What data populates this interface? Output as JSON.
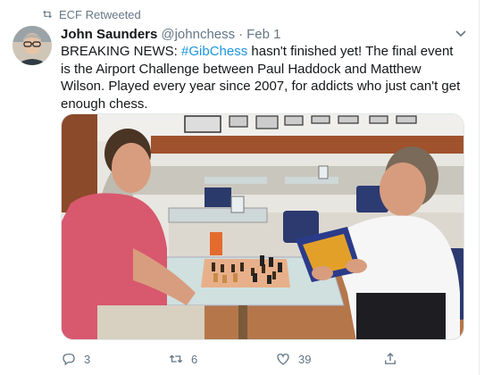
{
  "retweet": {
    "icon": "retweet-icon",
    "label": "ECF Retweeted"
  },
  "author": {
    "name": "John Saunders",
    "handle": "@johnchess",
    "separator": "·",
    "time": "Feb 1"
  },
  "tweet": {
    "text_part1": "BREAKING NEWS: ",
    "hashtag": "#GibChess",
    "text_part2": " hasn't  finished yet! The final event is the Airport Challenge between Paul Haddock and Matthew Wilson. Played every year since 2007, for addicts who just can't get enough chess."
  },
  "media": {
    "description_icon": "photo-chess-players"
  },
  "actions": {
    "replies": "3",
    "retweets": "6",
    "likes": "39"
  },
  "colors": {
    "link": "#1b95e0",
    "secondary": "#657786",
    "text": "#14171a"
  }
}
